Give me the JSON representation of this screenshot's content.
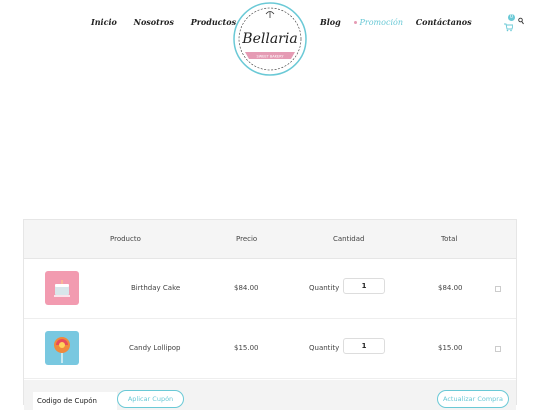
{
  "nav": {
    "left": [
      "Inicio",
      "Nosotros",
      "Productos"
    ],
    "right": {
      "blog": "Blog",
      "promo": "Promoción",
      "contact": "Contáctanos"
    }
  },
  "brand": {
    "name": "Bellaria",
    "ribbon": "SWEET BAKERY"
  },
  "cart": {
    "count": "0"
  },
  "colors": {
    "accent": "#6ac9d6",
    "pink": "#e59bb4"
  },
  "table": {
    "headers": {
      "product": "Producto",
      "price": "Precio",
      "quantity": "Cantidad",
      "total": "Total"
    },
    "quantity_label": "Quantity",
    "rows": [
      {
        "name": "Birthday Cake",
        "price": "$84.00",
        "qty": "1",
        "total": "$84.00"
      },
      {
        "name": "Candy Lollipop",
        "price": "$15.00",
        "qty": "1",
        "total": "$15.00"
      }
    ]
  },
  "actions": {
    "coupon_placeholder": "Codigo de Cupón",
    "apply": "Aplicar Cupón",
    "update": "Actualizar Compra"
  }
}
